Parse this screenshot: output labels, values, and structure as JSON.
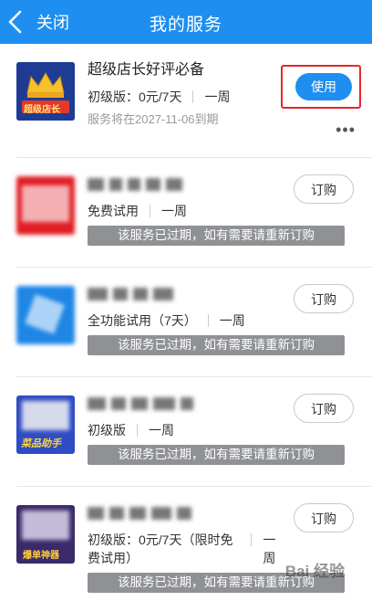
{
  "header": {
    "back_label": "关闭",
    "title": "我的服务"
  },
  "services": [
    {
      "name": "超级店长好评必备",
      "thumb_text": "超级店长",
      "plan": "初级版：0元/7天",
      "period": "一周",
      "expire_note": "服务将在2027-11-06到期",
      "button": "使用"
    },
    {
      "name": "",
      "thumb_text": "",
      "plan": "免费试用",
      "period": "一周",
      "expired_text": "该服务已过期，如有需要请重新订购",
      "button": "订购"
    },
    {
      "name": "",
      "thumb_text": "",
      "plan": "全功能试用（7天）",
      "period": "一周",
      "expired_text": "该服务已过期，如有需要请重新订购",
      "button": "订购"
    },
    {
      "name": "",
      "thumb_text": "菜品助手",
      "plan": "初级版",
      "period": "一周",
      "expired_text": "该服务已过期，如有需要请重新订购",
      "button": "订购"
    },
    {
      "name": "",
      "thumb_text": "爆单神器",
      "plan": "初级版：0元/7天（限时免费试用）",
      "period": "一周",
      "expired_text": "该服务已过期，如有需要请重新订购",
      "button": "订购"
    }
  ],
  "more_label": "•••",
  "watermark": "Bai 经验",
  "colors": {
    "accent": "#1e8ff0",
    "highlight": "#e8262a",
    "expired_bg": "#8f9195"
  }
}
